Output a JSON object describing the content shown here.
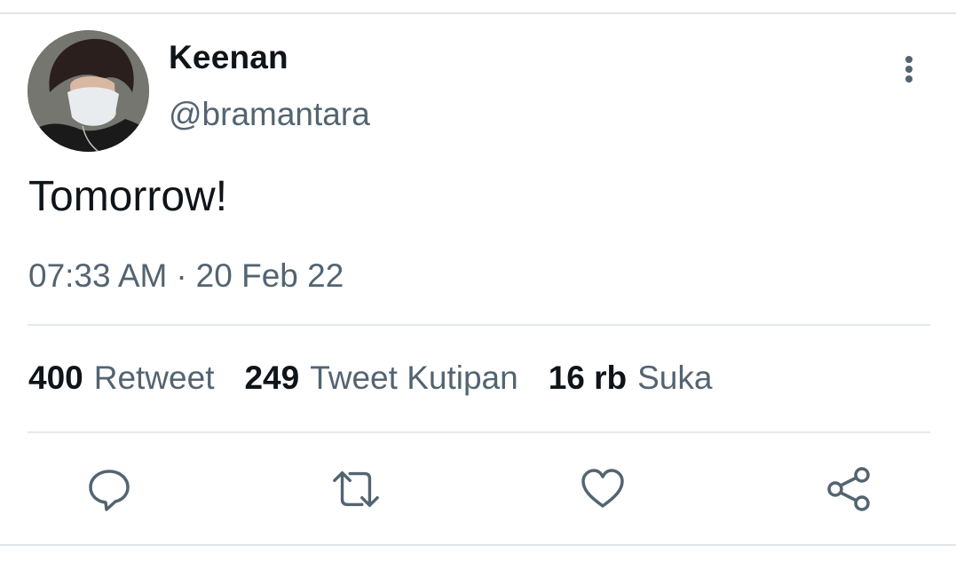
{
  "tweet": {
    "author": {
      "display_name": "Keenan",
      "handle": "@bramantara"
    },
    "text": "Tomorrow!",
    "time": "07:33 AM",
    "separator": "·",
    "date": "20 Feb 22",
    "stats": {
      "retweets": {
        "count": "400",
        "label": "Retweet"
      },
      "quotes": {
        "count": "249",
        "label": "Tweet Kutipan"
      },
      "likes": {
        "count": "16 rb",
        "label": "Suka"
      }
    }
  },
  "icons": {
    "more": "more-vertical-icon",
    "reply": "reply-bubble-icon",
    "retweet": "retweet-icon",
    "like": "heart-icon",
    "share": "share-icon"
  },
  "colors": {
    "text_primary": "#0f1419",
    "text_secondary": "#536471",
    "divider": "#e6e9ec"
  }
}
